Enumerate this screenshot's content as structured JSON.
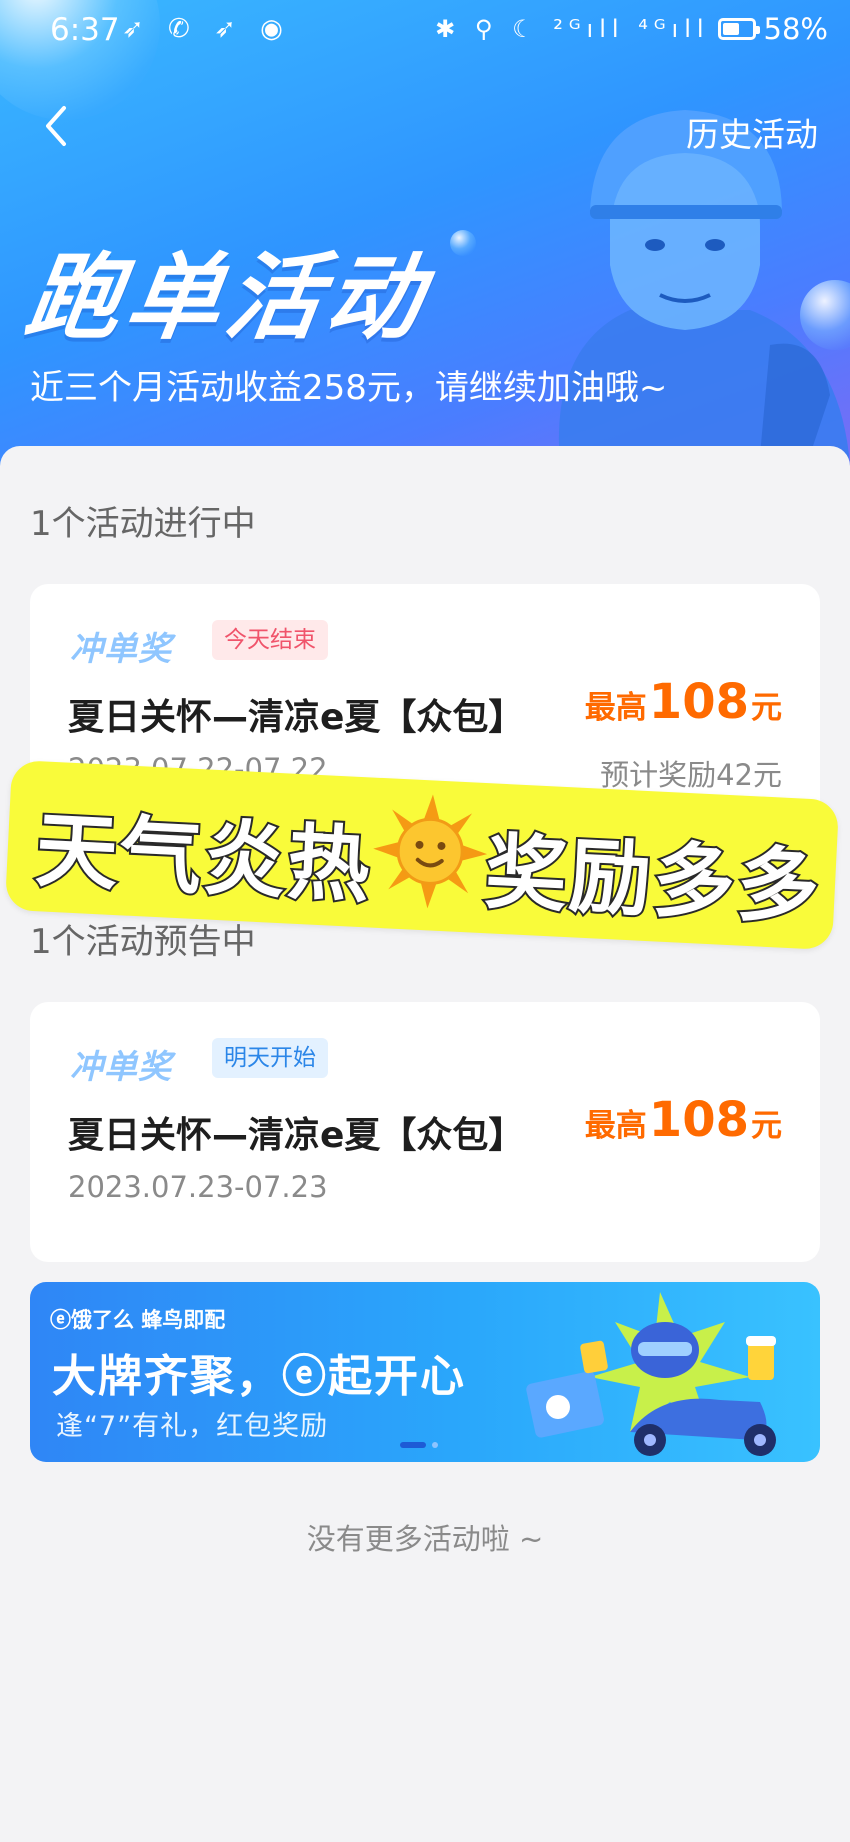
{
  "status_bar": {
    "time": "6:37",
    "left_icons": "➶ ✆ ➶ ◉",
    "right_icons": "✱ ⚲ ☾ ²ᴳıll ⁴ᴳıll",
    "battery": "58%"
  },
  "header": {
    "history_label": "历史活动",
    "title": "跑单活动",
    "subtitle": "近三个月活动收益258元，请继续加油哦~"
  },
  "sections": {
    "ongoing_heading": "1个活动进行中",
    "upcoming_heading": "1个活动预告中"
  },
  "activities": [
    {
      "type_label": "冲单奖",
      "badge": "今天结束",
      "title": "夏日关怀—清凉e夏【众包】",
      "reward_prefix": "最高",
      "reward_amount": "108",
      "reward_unit": "元",
      "date": "2023.07.22-07.22",
      "expected": "预计奖励42元"
    },
    {
      "type_label": "冲单奖",
      "badge": "明天开始",
      "title": "夏日关怀—清凉e夏【众包】",
      "reward_prefix": "最高",
      "reward_amount": "108",
      "reward_unit": "元",
      "date": "2023.07.23-07.23"
    }
  ],
  "sticker": {
    "text_left": "天气炎热",
    "text_right": "奖励多多"
  },
  "banner": {
    "logos": "ⓔ饿了么  蜂鸟即配",
    "title": "大牌齐聚，ⓔ起开心",
    "subtitle": "逢“7”有礼，红包奖励"
  },
  "footer": "没有更多活动啦 ~",
  "colors": {
    "accent_orange": "#ff6a00",
    "hero_blue": "#2f95ff",
    "badge_red": "#f0546b",
    "badge_blue": "#2b86e8"
  }
}
